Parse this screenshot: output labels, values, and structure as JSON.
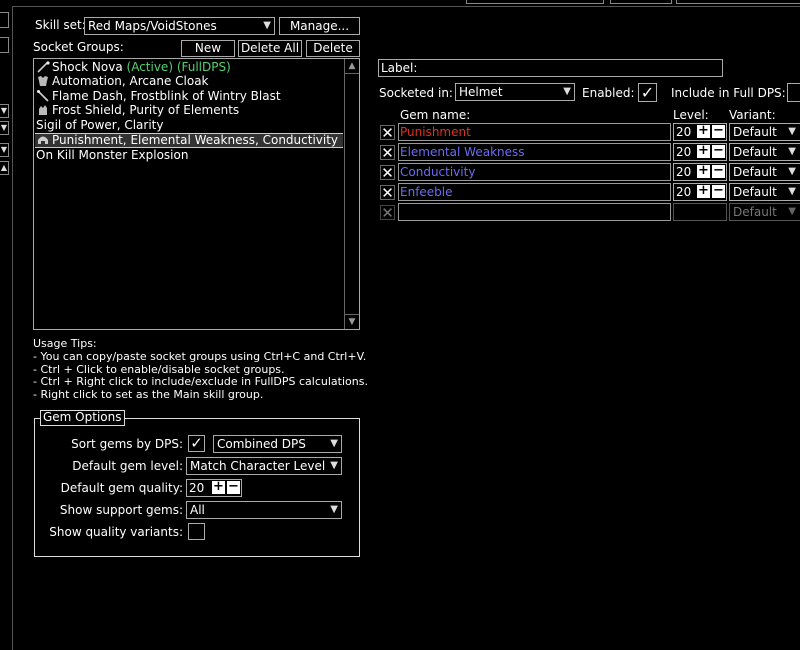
{
  "header": {
    "skill_set_label": "Skill set:",
    "skill_set_value": "Red Maps/VoidStones",
    "manage_label": "Manage..."
  },
  "socket_groups": {
    "label": "Socket Groups:",
    "new_label": "New",
    "delete_all_label": "Delete All",
    "delete_label": "Delete",
    "items": [
      {
        "text": "Shock Nova",
        "active": " (Active)",
        "fulldps": " (FullDPS)",
        "icon": "staff-icon"
      },
      {
        "text": "Automation, Arcane Cloak",
        "icon": "body-armour-icon"
      },
      {
        "text": "Flame Dash, Frostblink of Wintry Blast",
        "icon": "wand-icon"
      },
      {
        "text": "Frost Shield, Purity of Elements",
        "icon": "gloves-icon"
      },
      {
        "text": "Sigil of Power, Clarity",
        "icon": ""
      },
      {
        "text": "Punishment, Elemental Weakness, Conductivity",
        "icon": "helmet-icon"
      },
      {
        "text": "On Kill Monster Explosion",
        "icon": ""
      }
    ]
  },
  "usage_tips": {
    "title": "Usage Tips:",
    "lines": [
      "- You can copy/paste socket groups using Ctrl+C and Ctrl+V.",
      "- Ctrl + Click to enable/disable socket groups.",
      "- Ctrl + Right click to include/exclude in FullDPS calculations.",
      "- Right click to set as the Main skill group."
    ]
  },
  "gem_options": {
    "title": "Gem Options",
    "sort_label": "Sort gems by DPS:",
    "sort_value": "Combined DPS",
    "default_level_label": "Default gem level:",
    "default_level_value": "Match Character Level",
    "default_quality_label": "Default gem quality:",
    "default_quality_value": "20",
    "show_support_label": "Show support gems:",
    "show_support_value": "All",
    "show_quality_label": "Show quality variants:"
  },
  "group_editor": {
    "label_label": "Label:",
    "socketed_label": "Socketed in:",
    "socketed_value": "Helmet",
    "enabled_label": "Enabled:",
    "include_label": "Include in Full DPS:",
    "col_gem_name": "Gem name:",
    "col_level": "Level:",
    "col_variant": "Variant:",
    "gems": [
      {
        "name": "Punishment",
        "level": "20",
        "variant": "Default",
        "color": "#e0321e"
      },
      {
        "name": "Elemental Weakness",
        "level": "20",
        "variant": "Default",
        "color": "#6d6bf4"
      },
      {
        "name": "Conductivity",
        "level": "20",
        "variant": "Default",
        "color": "#6d6bf4"
      },
      {
        "name": "Enfeeble",
        "level": "20",
        "variant": "Default",
        "color": "#6d6bf4"
      }
    ],
    "empty_variant": "Default"
  },
  "glyphs": {
    "check": "✓",
    "cross": "✕",
    "plus": "+",
    "minus": "−",
    "arrow_down": "▼",
    "arrow_up": "▲"
  }
}
